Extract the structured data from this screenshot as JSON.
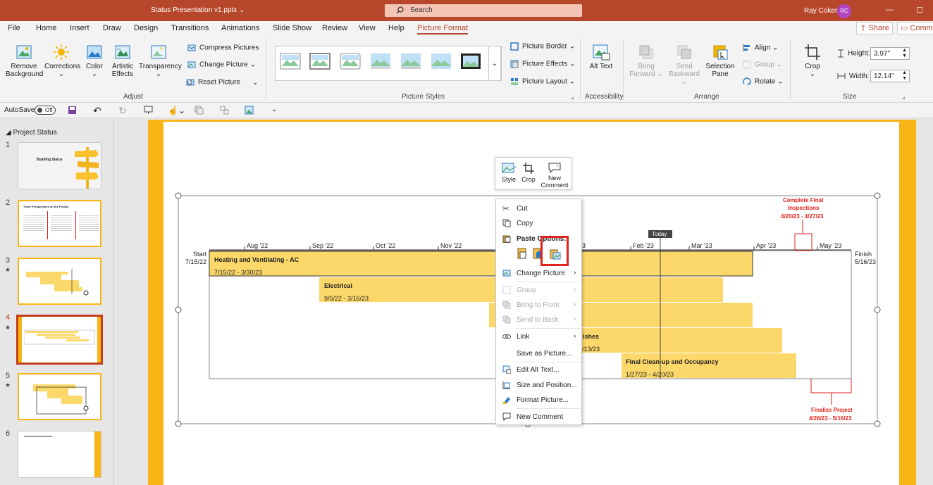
{
  "window": {
    "doc_title": "Status Presentation v1.pptx",
    "doc_caret": "⌄",
    "search_placeholder": "Search",
    "user_name": "Ray Coker",
    "user_initials": "RC",
    "minimize": "—",
    "maximize": "☐"
  },
  "tabs": [
    {
      "label": "File"
    },
    {
      "label": "Home"
    },
    {
      "label": "Insert"
    },
    {
      "label": "Draw"
    },
    {
      "label": "Design"
    },
    {
      "label": "Transitions"
    },
    {
      "label": "Animations"
    },
    {
      "label": "Slide Show"
    },
    {
      "label": "Review"
    },
    {
      "label": "View"
    },
    {
      "label": "Help"
    },
    {
      "label": "Picture Format"
    }
  ],
  "share_label": "Share",
  "comments_label": "Comme",
  "ribbon": {
    "adjust": {
      "remove_background": "Remove Background",
      "corrections": "Corrections",
      "color": "Color",
      "artistic_effects": "Artistic Effects",
      "transparency": "Transparency",
      "compress": "Compress Pictures",
      "change": "Change Picture",
      "reset": "Reset Picture",
      "group_label": "Adjust"
    },
    "styles": {
      "border": "Picture Border",
      "effects": "Picture Effects",
      "layout": "Picture Layout",
      "group_label": "Picture Styles"
    },
    "accessibility": {
      "alt_text": "Alt Text",
      "group_label": "Accessibility"
    },
    "arrange": {
      "bring_forward": "Bring Forward",
      "send_backward": "Send Backward",
      "selection_pane": "Selection Pane",
      "align": "Align",
      "group": "Group",
      "rotate": "Rotate",
      "group_label": "Arrange"
    },
    "size": {
      "crop": "Crop",
      "height_label": "Height:",
      "height_value": "3.97\"",
      "width_label": "Width:",
      "width_value": "12.14\"",
      "group_label": "Size"
    }
  },
  "qat": {
    "autosave_label": "AutoSave",
    "autosave_state": "Off"
  },
  "slides_pane": {
    "section": "Project Status",
    "numbers": [
      "1",
      "2",
      "3",
      "4",
      "5",
      "6"
    ],
    "star": "★",
    "thumb1_title": "Building Status",
    "thumb2_title": "Three Perspectives on the Project"
  },
  "minibar": {
    "style": "Style",
    "crop": "Crop",
    "new_comment": "New Comment"
  },
  "context_menu": {
    "cut": "Cut",
    "copy": "Copy",
    "paste_options": "Paste Options:",
    "change_picture": "Change Picture",
    "group": "Group",
    "bring_to_front": "Bring to Front",
    "send_to_back": "Send to Back",
    "link": "Link",
    "save_as_picture": "Save as Picture...",
    "edit_alt_text": "Edit Alt Text...",
    "size_and_position": "Size and Position...",
    "format_picture": "Format Picture...",
    "new_comment": "New Comment",
    "submenu_arrow": "›"
  },
  "timeline": {
    "start_label": "Start",
    "start_date": "7/15/22",
    "finish_label": "Finish",
    "finish_date": "5/16/23",
    "today_label": "Today",
    "months": [
      "Aug '22",
      "Sep '22",
      "Oct '22",
      "Nov '22",
      "Feb '23",
      "Mar '23",
      "Apr '23",
      "May '23"
    ],
    "month_fragment": "3",
    "tasks": [
      {
        "name": "Heating and Ventilating - AC",
        "dates": "7/15/22 - 3/30/23"
      },
      {
        "name": "Electrical",
        "dates": "9/5/22 - 3/16/23"
      },
      {
        "name": "ishes",
        "dates": "/13/23"
      },
      {
        "name": "Final Clean-up and Occupancy",
        "dates": "1/27/23 - 4/20/23"
      }
    ],
    "milestone_top": {
      "title_1": "Complete Final",
      "title_2": "Inspections",
      "dates": "4/20/23 - 4/27/23"
    },
    "milestone_bottom": {
      "title": "Finalize Project",
      "dates": "4/28/23 - 5/16/23"
    }
  },
  "colors": {
    "accent": "#b7472a",
    "bar": "#fcd86a",
    "slide_border": "#f9b516",
    "milestone": "#e2221c",
    "highlight": "#e2221c"
  }
}
